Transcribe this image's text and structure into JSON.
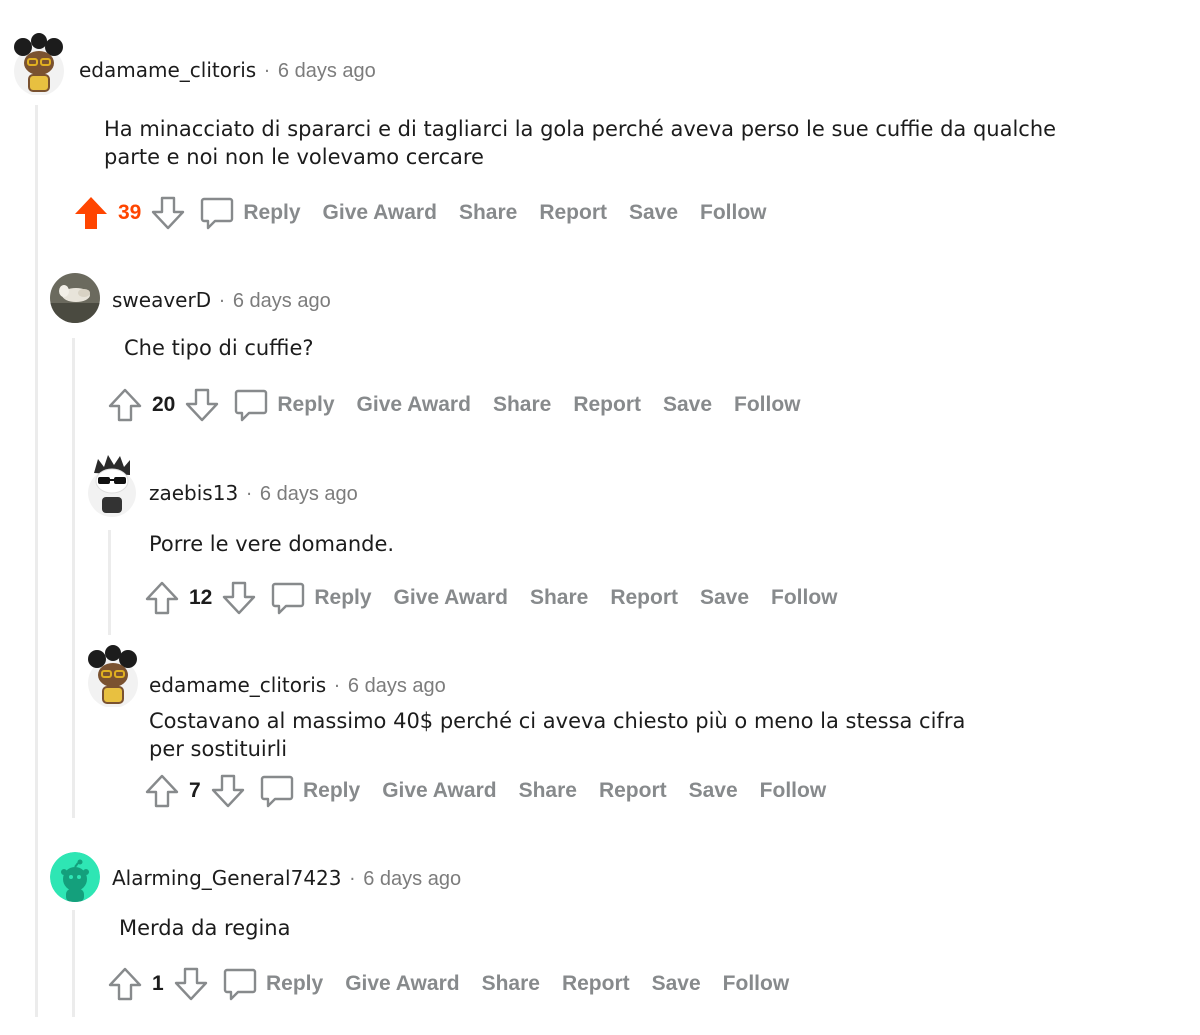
{
  "colors": {
    "upvote_active": "#ff4500",
    "action_text": "#878a8c",
    "meta_text": "#7c7c7c",
    "body_text": "#1c1c1c",
    "rail": "#ececec"
  },
  "actions": {
    "reply": "Reply",
    "give_award": "Give Award",
    "share": "Share",
    "report": "Report",
    "save": "Save",
    "follow": "Follow"
  },
  "separator": "·",
  "comments": [
    {
      "username": "edamame_clitoris",
      "time": "6 days ago",
      "body_lines": [
        "Ha minacciato di spararci e di tagliarci la gola perché aveva perso le sue cuffie da qualche",
        "parte e noi non le volevamo cercare"
      ],
      "score": "39",
      "upvoted": true,
      "avatar_icon": "snoo-avatar-afro-icon"
    },
    {
      "username": "sweaverD",
      "time": "6 days ago",
      "body_lines": [
        "Che tipo di cuffie?"
      ],
      "score": "20",
      "upvoted": false,
      "avatar_icon": "photo-avatar-icon"
    },
    {
      "username": "zaebis13",
      "time": "6 days ago",
      "body_lines": [
        "Porre le vere domande."
      ],
      "score": "12",
      "upvoted": false,
      "avatar_icon": "snoo-avatar-sunglasses-icon"
    },
    {
      "username": "edamame_clitoris",
      "time": "6 days ago",
      "body_lines": [
        "Costavano al massimo 40$ perché ci aveva chiesto più o meno la stessa cifra",
        "per sostituirli"
      ],
      "score": "7",
      "upvoted": false,
      "avatar_icon": "snoo-avatar-afro-icon"
    },
    {
      "username": "Alarming_General7423",
      "time": "6 days ago",
      "body_lines": [
        "Merda da regina"
      ],
      "score": "1",
      "upvoted": false,
      "avatar_icon": "default-snoo-avatar-icon"
    }
  ]
}
